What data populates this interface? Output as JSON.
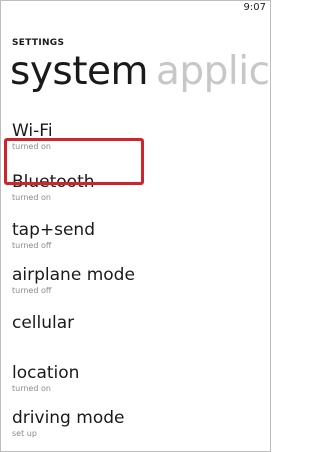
{
  "status_bar": {
    "time": "9:07"
  },
  "header": {
    "title": "SETTINGS"
  },
  "pivot": {
    "active_label": "system",
    "next_label": "applica"
  },
  "items": [
    {
      "title": "Wi-Fi",
      "subtitle": "turned on"
    },
    {
      "title": "Bluetooth",
      "subtitle": "turned on"
    },
    {
      "title": "tap+send",
      "subtitle": "turned off"
    },
    {
      "title": "airplane mode",
      "subtitle": "turned off"
    },
    {
      "title": "cellular",
      "subtitle": ""
    },
    {
      "title": "location",
      "subtitle": "turned on"
    },
    {
      "title": "driving mode",
      "subtitle": "set up"
    }
  ],
  "highlight": {
    "target": "Bluetooth",
    "color": "#d0232b"
  }
}
